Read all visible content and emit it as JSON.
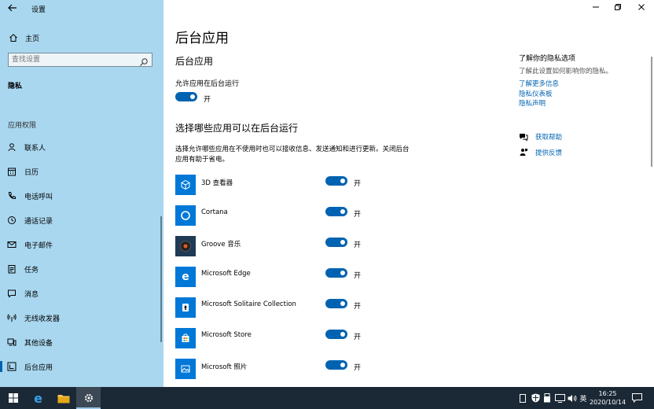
{
  "window": {
    "title": "设置"
  },
  "sidebar": {
    "home_label": "主页",
    "search_placeholder": "查找设置",
    "category": "隐私",
    "group_header": "应用权限",
    "items": [
      {
        "label": "联系人",
        "icon": "contacts-icon"
      },
      {
        "label": "日历",
        "icon": "calendar-icon"
      },
      {
        "label": "电话呼叫",
        "icon": "phone-icon"
      },
      {
        "label": "通话记录",
        "icon": "call-history-icon"
      },
      {
        "label": "电子邮件",
        "icon": "mail-icon"
      },
      {
        "label": "任务",
        "icon": "tasks-icon"
      },
      {
        "label": "消息",
        "icon": "messaging-icon"
      },
      {
        "label": "无线收发器",
        "icon": "radios-icon"
      },
      {
        "label": "其他设备",
        "icon": "other-devices-icon"
      },
      {
        "label": "后台应用",
        "icon": "background-apps-icon",
        "active": true
      }
    ]
  },
  "main": {
    "title": "后台应用",
    "section1_title": "后台应用",
    "allow_label": "允许应用在后台运行",
    "allow_state": "开",
    "section2_title": "选择哪些应用可以在后台运行",
    "description": "选择允许哪些应用在不使用时也可以接收信息、发送通知和进行更新。关闭后台应用有助于省电。",
    "apps": [
      {
        "name": "3D 查看器",
        "state": "开",
        "icon": "3d-viewer-icon"
      },
      {
        "name": "Cortana",
        "state": "开",
        "icon": "cortana-icon"
      },
      {
        "name": "Groove 音乐",
        "state": "开",
        "icon": "groove-music-icon"
      },
      {
        "name": "Microsoft Edge",
        "state": "开",
        "icon": "edge-icon"
      },
      {
        "name": "Microsoft Solitaire Collection",
        "state": "开",
        "icon": "solitaire-icon"
      },
      {
        "name": "Microsoft Store",
        "state": "开",
        "icon": "store-icon"
      },
      {
        "name": "Microsoft 照片",
        "state": "开",
        "icon": "photos-icon"
      }
    ]
  },
  "right_panel": {
    "heading": "了解你的隐私选项",
    "subtext": "了解此设置如何影响你的隐私。",
    "links": [
      "了解更多信息",
      "隐私仪表板",
      "隐私声明"
    ],
    "help_label": "获取帮助",
    "feedback_label": "提供反馈"
  },
  "taskbar": {
    "time": "16:25",
    "date": "2020/10/14",
    "ime": "英"
  },
  "colors": {
    "accent": "#0063b1",
    "sidebar_bg": "#a9d7ef",
    "tile": "#0078d7",
    "taskbar": "#1b2836"
  }
}
